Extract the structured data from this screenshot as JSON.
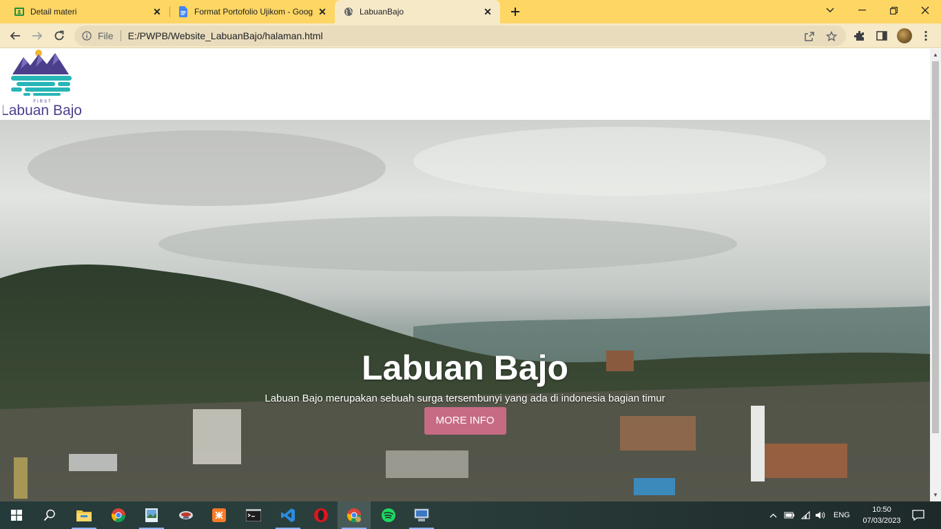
{
  "browser": {
    "tabs": [
      {
        "title": "Detail materi",
        "favicon": "classroom-icon",
        "active": false
      },
      {
        "title": "Format Portofolio Ujikom - Goog",
        "favicon": "docs-icon",
        "active": false
      },
      {
        "title": "LabuanBajo",
        "favicon": "globe-icon",
        "active": true
      }
    ],
    "address": {
      "scheme_label": "File",
      "url": "E:/PWPB/Website_LabuanBajo/halaman.html"
    },
    "accent": "#fdd663"
  },
  "page": {
    "logo": {
      "top_text": "FIRST",
      "main_text": "Labuan Bajo"
    },
    "hero": {
      "title": "Labuan Bajo",
      "subtitle": "Labuan Bajo merupakan sebuah surga tersembunyi yang ada di indonesia bagian timur",
      "button_label": "MORE INFO",
      "button_color": "#c76b85"
    }
  },
  "taskbar": {
    "apps": [
      "file-explorer-icon",
      "chrome-icon",
      "paint-icon",
      "app-icon",
      "xampp-icon",
      "terminal-icon",
      "vscode-icon",
      "opera-icon",
      "chrome-active-icon",
      "spotify-icon",
      "network-app-icon"
    ],
    "language": "ENG",
    "time": "10:50",
    "date": "07/03/2023"
  }
}
